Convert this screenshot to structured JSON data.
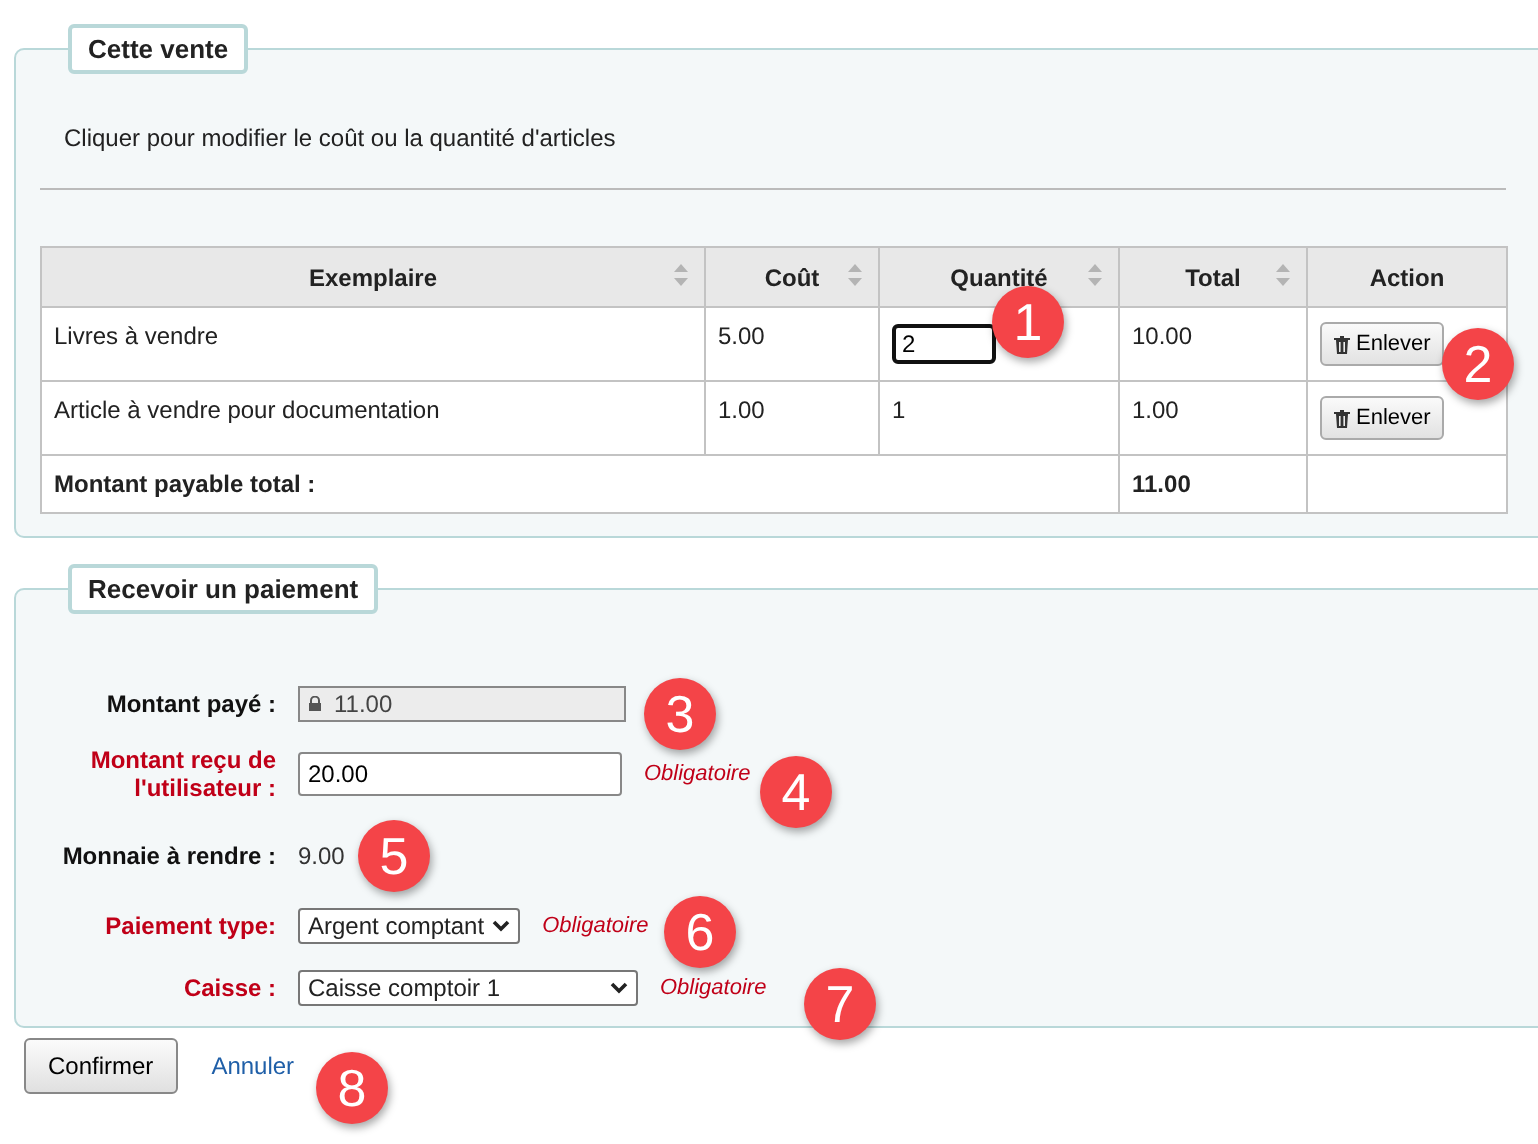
{
  "sale": {
    "legend": "Cette vente",
    "hint": "Cliquer pour modifier le coût ou la quantité d'articles",
    "columns": [
      {
        "label": "Exemplaire",
        "sortable": true
      },
      {
        "label": "Coût",
        "sortable": true
      },
      {
        "label": "Quantité",
        "sortable": true
      },
      {
        "label": "Total",
        "sortable": true
      },
      {
        "label": "Action",
        "sortable": false
      }
    ],
    "rows": [
      {
        "item": "Livres à vendre",
        "cost": "5.00",
        "quantity": "2",
        "quantity_editing": true,
        "total": "10.00",
        "action": "Enlever"
      },
      {
        "item": "Article à vendre pour documentation",
        "cost": "1.00",
        "quantity": "1",
        "quantity_editing": false,
        "total": "1.00",
        "action": "Enlever"
      }
    ],
    "footer": {
      "label": "Montant payable total :",
      "total": "11.00"
    }
  },
  "payment": {
    "legend": "Recevoir un paiement",
    "fields": [
      {
        "kind": "readonly",
        "label": "Montant payé :",
        "required": false,
        "value": "11.00"
      },
      {
        "kind": "input",
        "label": "Montant reçu de l'utilisateur :",
        "required": true,
        "value": "20.00",
        "note": "Obligatoire"
      },
      {
        "kind": "text",
        "label": "Monnaie à rendre :",
        "required": false,
        "value": "9.00"
      },
      {
        "kind": "select",
        "label": "Paiement type:",
        "required": true,
        "value": "Argent comptant",
        "note": "Obligatoire",
        "wide": false
      },
      {
        "kind": "select",
        "label": "Caisse :",
        "required": true,
        "value": "Caisse comptoir 1",
        "note": "Obligatoire",
        "wide": true
      }
    ]
  },
  "actions": {
    "confirm": "Confirmer",
    "cancel": "Annuler"
  },
  "callouts": [
    "1",
    "2",
    "3",
    "4",
    "5",
    "6",
    "7",
    "8"
  ]
}
